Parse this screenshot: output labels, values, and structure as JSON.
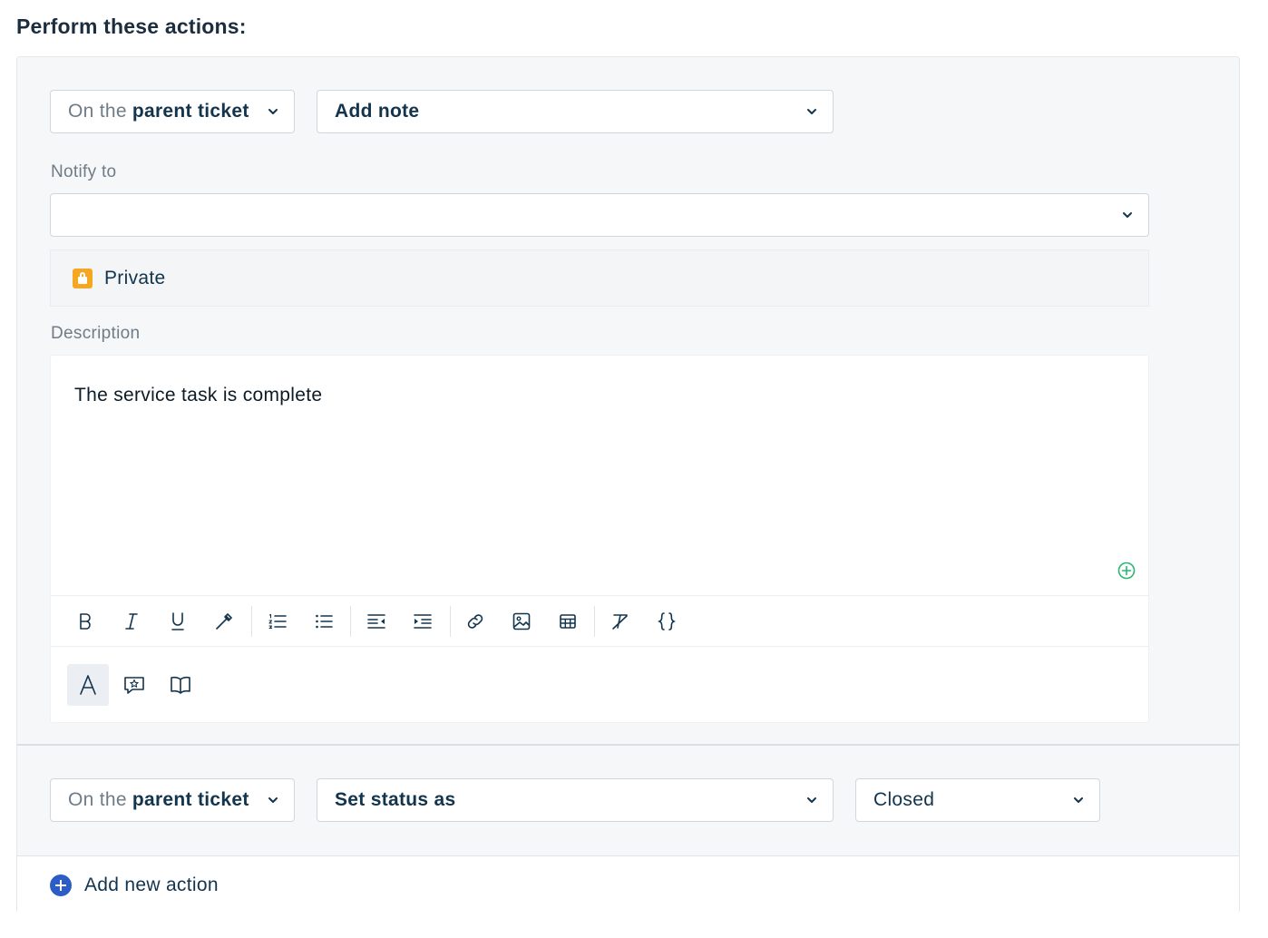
{
  "heading": "Perform these actions:",
  "actions": [
    {
      "scope": {
        "prefix": "On the",
        "value": "parent ticket"
      },
      "action": "Add note",
      "notify_label": "Notify to",
      "notify_value": "",
      "private_label": "Private",
      "description_label": "Description",
      "description_text": "The service task is complete"
    },
    {
      "scope": {
        "prefix": "On the",
        "value": "parent ticket"
      },
      "action": "Set status as",
      "status": "Closed"
    }
  ],
  "toolbar_icons": [
    "bold-icon",
    "italic-icon",
    "underline-icon",
    "text-color-icon",
    "ordered-list-icon",
    "unordered-list-icon",
    "outdent-icon",
    "indent-icon",
    "link-icon",
    "image-icon",
    "table-icon",
    "clear-format-icon",
    "code-braces-icon"
  ],
  "mode_icons": [
    "text-mode-icon",
    "canned-response-icon",
    "knowledge-base-icon"
  ],
  "footer": {
    "add_action_label": "Add new action"
  },
  "colors": {
    "accent": "#2c5cc5",
    "lock": "#f5a623",
    "add_green": "#2bb673"
  }
}
